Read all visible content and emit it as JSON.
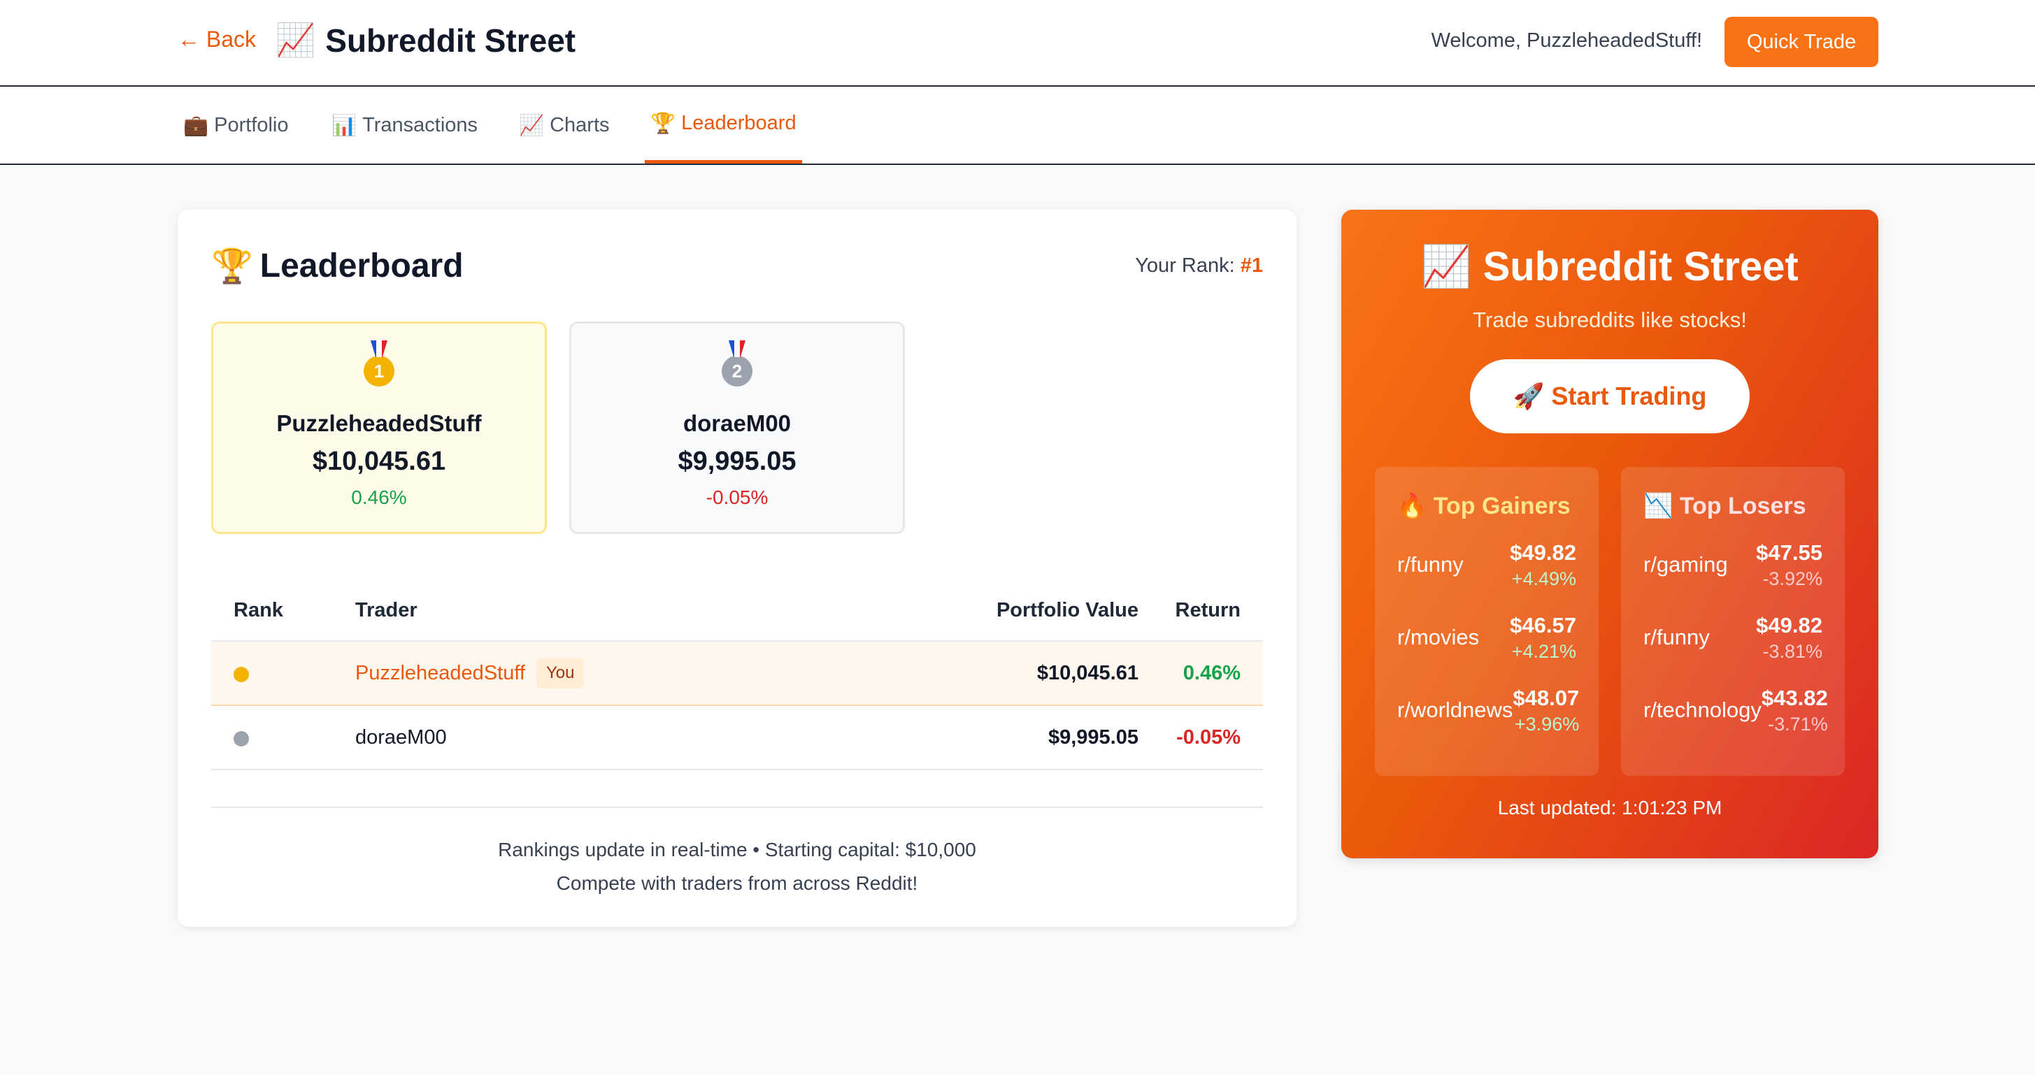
{
  "header": {
    "back_label": "← Back",
    "title_icon": "📈",
    "title": "Subreddit Street",
    "welcome": "Welcome, PuzzleheadedStuff!",
    "quick_trade_label": "Quick Trade"
  },
  "nav": {
    "tabs": [
      {
        "icon": "💼",
        "label": "Portfolio"
      },
      {
        "icon": "📊",
        "label": "Transactions"
      },
      {
        "icon": "📈",
        "label": "Charts"
      },
      {
        "icon": "🏆",
        "label": "Leaderboard",
        "active": true
      }
    ]
  },
  "leaderboard": {
    "icon": "🏆",
    "title": "Leaderboard",
    "your_rank_label": "Your Rank:",
    "your_rank_value": "#1",
    "podium": [
      {
        "medal": "1",
        "name": "PuzzleheadedStuff",
        "value": "$10,045.61",
        "return": "0.46%"
      },
      {
        "medal": "2",
        "name": "doraeM00",
        "value": "$9,995.05",
        "return": "-0.05%"
      }
    ],
    "columns": {
      "rank": "Rank",
      "trader": "Trader",
      "value": "Portfolio Value",
      "return": "Return"
    },
    "rows": [
      {
        "name": "PuzzleheadedStuff",
        "badge": "You",
        "value": "$10,045.61",
        "return": "0.46%"
      },
      {
        "name": "doraeM00",
        "value": "$9,995.05",
        "return": "-0.05%"
      }
    ],
    "footer_line1": "Rankings update in real-time • Starting capital: $10,000",
    "footer_line2": "Compete with traders from across Reddit!"
  },
  "promo": {
    "title": "📈 Subreddit Street",
    "subtitle": "Trade subreddits like stocks!",
    "start_label": "🚀 Start Trading",
    "gainers_title": "🔥 Top Gainers",
    "losers_title": "📉 Top Losers",
    "gainers": [
      {
        "name": "r/funny",
        "price": "$49.82",
        "change": "+4.49%"
      },
      {
        "name": "r/movies",
        "price": "$46.57",
        "change": "+4.21%"
      },
      {
        "name": "r/worldnews",
        "price": "$48.07",
        "change": "+3.96%"
      }
    ],
    "losers": [
      {
        "name": "r/gaming",
        "price": "$47.55",
        "change": "-3.92%"
      },
      {
        "name": "r/funny",
        "price": "$49.82",
        "change": "-3.81%"
      },
      {
        "name": "r/technology",
        "price": "$43.82",
        "change": "-3.71%"
      }
    ],
    "updated": "Last updated: 1:01:23 PM"
  }
}
